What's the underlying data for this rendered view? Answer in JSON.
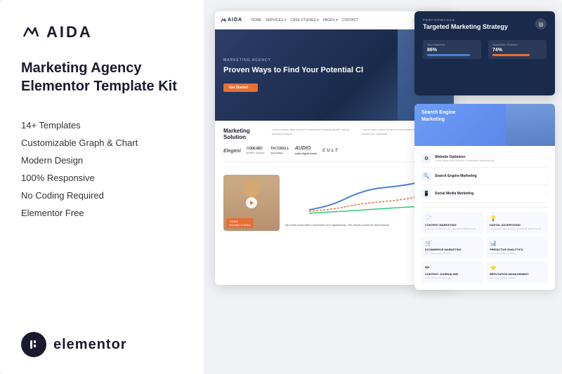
{
  "brand": {
    "name": "AIDA",
    "icon": "↗",
    "tagline_line1": "Marketing Agency",
    "tagline_line2": "Elementor Template Kit"
  },
  "features": [
    "14+ Templates",
    "Customizable Graph & Chart",
    "Modern Design",
    "100% Responsive",
    "No Coding Required",
    "Elementor Free"
  ],
  "elementor": {
    "label": "elementor"
  },
  "preview": {
    "navbar": {
      "logo": "AIDA",
      "links": [
        "HOME",
        "SERVICES",
        "CASE STUDIES",
        "PAGES",
        "CONTACT"
      ]
    },
    "hero": {
      "agency_label": "MARKETING AGENCY",
      "title": "Proven Ways to Find Your Potential Cl",
      "cta": "Get Started →"
    },
    "marketing": {
      "title": "Marketing Solution",
      "text": "Lorem ipsum dolor sit amet, consectetur adipiscing elit, sed do eiusmod tempor incididunt. Teltus, lectus nec vulputate dignissim, molestie eu lorem.",
      "brands": [
        "Elegeni",
        "CODE RED",
        "TACOBELL",
        "AUDIO",
        "CULT"
      ]
    },
    "chart": {
      "stat": "+216%",
      "stat_label": "Increase in Sales",
      "testimonial": "My email subscribers increased very significantly. The results speak for themselves!"
    },
    "top_right": {
      "label": "PERFORMANCE",
      "title": "Targeted Marketing Strategy",
      "stat1_label": "Your Segment",
      "stat1_value": "86%",
      "stat2_label": "Acquisition Channel",
      "stat2_value": "74%"
    },
    "services": {
      "title": "Search Engine Marketing",
      "items": [
        {
          "name": "Website Optimizer",
          "desc": "Lorem ipsum dolor sit amet, consectetur adipiscing elit.",
          "icon": "⚙"
        },
        {
          "name": "Search Engine Marketing",
          "desc": "",
          "icon": "🔍"
        },
        {
          "name": "Social Media Marketing",
          "desc": "",
          "icon": "📱"
        }
      ],
      "grid": [
        {
          "title": "CONTENT MARKETING",
          "text": "Lorem ipsum dolor sit amet, consectetur adipiscing elit.",
          "icon": "📄"
        },
        {
          "title": "DIGITAL ADVERTISING",
          "text": "Lorem ipsum dolor sit amet, consectetur adipiscing elit.",
          "icon": "💡"
        },
        {
          "title": "ECOMMERCE MARKETING",
          "text": "Lorem ipsum dolor sit amet.",
          "icon": "🛒"
        },
        {
          "title": "PREDICTIVE ANALYTICS",
          "text": "Lorem ipsum dolor sit amet.",
          "icon": "📊"
        },
        {
          "title": "CONTENT JOURNALISM",
          "text": "Lorem ipsum dolor sit amet.",
          "icon": "✏"
        },
        {
          "title": "REPUTATION MANAGEMENT",
          "text": "Lorem ipsum dolor sit amet.",
          "icon": "⭐"
        }
      ]
    }
  }
}
